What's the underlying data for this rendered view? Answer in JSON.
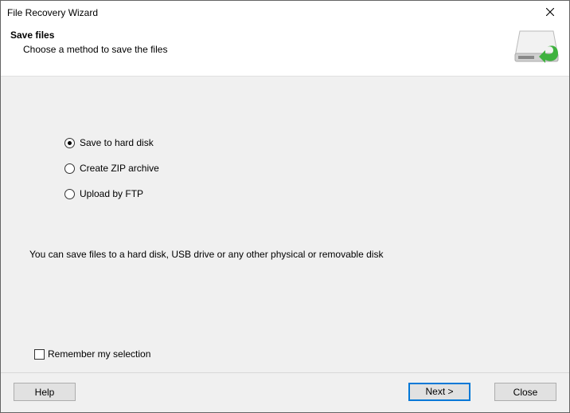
{
  "window": {
    "title": "File Recovery Wizard"
  },
  "header": {
    "title": "Save files",
    "subtitle": "Choose a method to save the files"
  },
  "options": {
    "save_hdd": "Save to hard disk",
    "create_zip": "Create ZIP archive",
    "upload_ftp": "Upload by FTP"
  },
  "description": "You can save files to a hard disk, USB drive or any other physical or removable disk",
  "remember": {
    "label": "Remember my selection"
  },
  "buttons": {
    "help": "Help",
    "next": "Next >",
    "close": "Close"
  }
}
